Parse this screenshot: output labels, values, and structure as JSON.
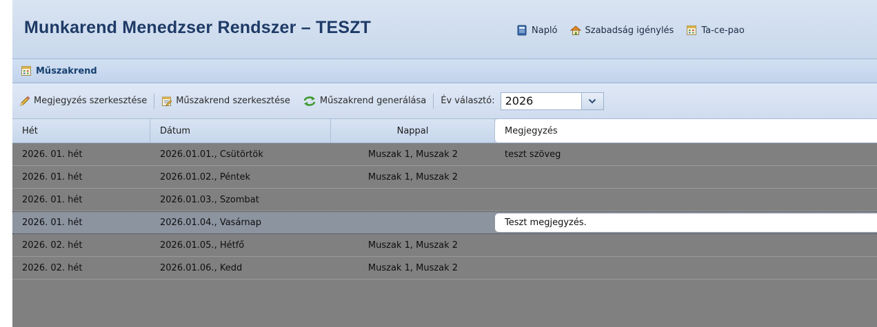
{
  "app": {
    "title": "Munkarend Menedzser Rendszer – TESZT",
    "nav": [
      {
        "label": "Napló",
        "icon": "notebook-icon"
      },
      {
        "label": "Szabadság igénylés",
        "icon": "house-icon"
      },
      {
        "label": "Ta-ce-pao",
        "icon": "calendar-icon"
      }
    ]
  },
  "panel": {
    "title": "Műszakrend",
    "icon": "calendar-icon"
  },
  "toolbar": {
    "edit_note": "Megjegyzés szerkesztése",
    "edit_shift": "Műszakrend szerkesztése",
    "generate_shift": "Műszakrend generálása",
    "year_label": "Év választó:",
    "year_value": "2026"
  },
  "grid": {
    "columns": [
      "Hét",
      "Dátum",
      "Nappal",
      "Megjegyzés"
    ],
    "rows": [
      {
        "het": "2026. 01. hét",
        "datum": "2026.01.01., Csütörtök",
        "nappal": "Muszak 1, Muszak 2",
        "megjegyzes": "teszt szöveg"
      },
      {
        "het": "2026. 01. hét",
        "datum": "2026.01.02., Péntek",
        "nappal": "Muszak 1, Muszak 2",
        "megjegyzes": ""
      },
      {
        "het": "2026. 01. hét",
        "datum": "2026.01.03., Szombat",
        "nappal": "",
        "megjegyzes": ""
      },
      {
        "het": "2026. 01. hét",
        "datum": "2026.01.04., Vasárnap",
        "nappal": "",
        "megjegyzes": "Teszt megjegyzés."
      },
      {
        "het": "2026. 02. hét",
        "datum": "2026.01.05., Hétfő",
        "nappal": "Muszak 1, Muszak 2",
        "megjegyzes": ""
      },
      {
        "het": "2026. 02. hét",
        "datum": "2026.01.06., Kedd",
        "nappal": "Muszak 1, Muszak 2",
        "megjegyzes": ""
      }
    ],
    "selected_row": 3
  }
}
